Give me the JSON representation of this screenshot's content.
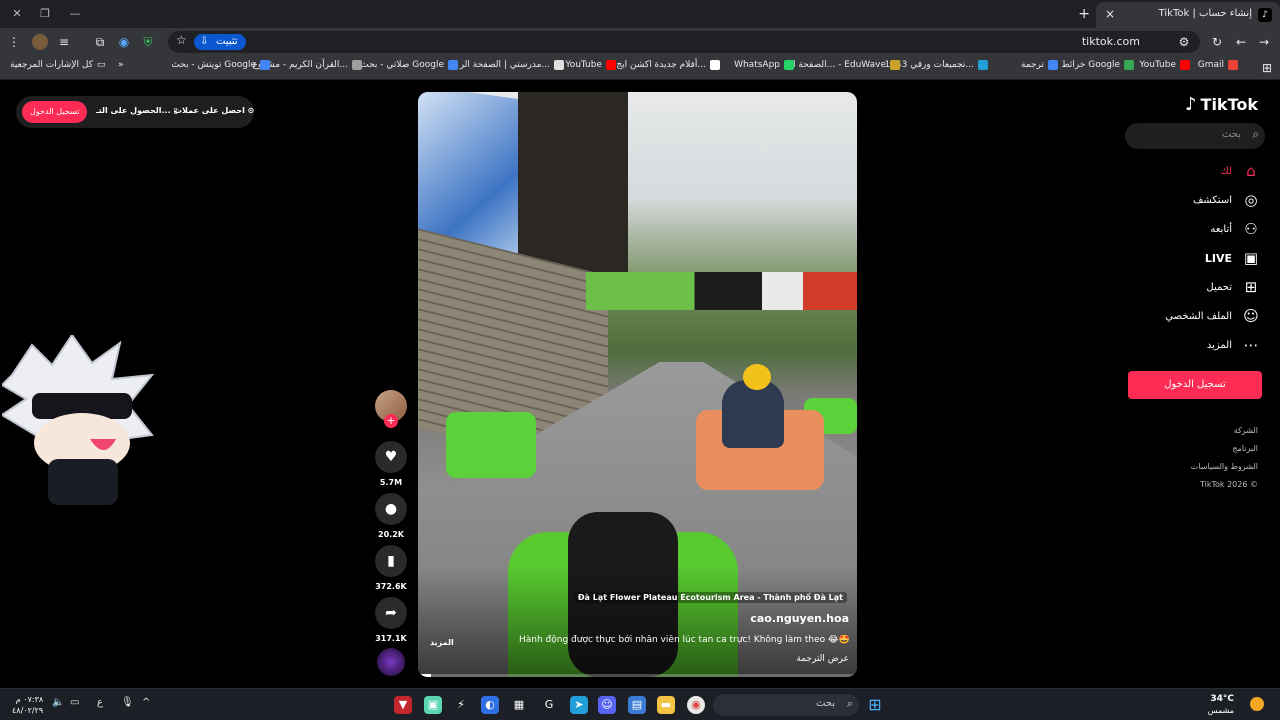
{
  "browser": {
    "tab_title": "إنشاء حساب | TikTok",
    "tab_close": "×",
    "new_tab": "+",
    "url": "tiktok.com",
    "install_label": "تثبيت",
    "minimize": "—",
    "restore": "❐",
    "close": "✕"
  },
  "bookmarks": {
    "all_bookmarks": "كل الإشارات المرجعية",
    "overflow": "»",
    "items": [
      {
        "label": "Gmail",
        "color": "#ea4335"
      },
      {
        "label": "YouTube",
        "color": "#ff0000"
      },
      {
        "label": "خرائط Google",
        "color": "#34a853"
      },
      {
        "label": "ترجمة",
        "color": "#4285f4"
      },
      {
        "label": "تجميعات ورقي 1443...",
        "color": "#229ed9"
      },
      {
        "label": "الصفحة ا... - EduWave",
        "color": "#c9a227"
      },
      {
        "label": "WhatsApp",
        "color": "#25d366"
      },
      {
        "label": "أفلام جديدة اكشن ايج...",
        "color": "#ffffff"
      },
      {
        "label": "YouTube",
        "color": "#ff0000"
      },
      {
        "label": "مدرستي | الصفحة الر...",
        "color": "#e0e0e0"
      },
      {
        "label": "صلاتي - بحث Google",
        "color": "#4285f4"
      },
      {
        "label": "القرآن الكريم - مشروع...",
        "color": "#9e9e9e"
      },
      {
        "label": "تويتش - بحث Google",
        "color": "#4285f4"
      }
    ]
  },
  "tiktok": {
    "logo": "TikTok",
    "search_placeholder": "بحث",
    "nav": [
      {
        "label": "لك",
        "icon": "home-icon",
        "glyph": "⌂"
      },
      {
        "label": "استكشف",
        "icon": "compass-icon",
        "glyph": "◎"
      },
      {
        "label": "أتابعه",
        "icon": "following-icon",
        "glyph": "⚇"
      },
      {
        "label": "LIVE",
        "icon": "live-icon",
        "glyph": "▣"
      },
      {
        "label": "تحميل",
        "icon": "upload-icon",
        "glyph": "⊞"
      },
      {
        "label": "الملف الشخصي",
        "icon": "profile-icon",
        "glyph": "☺"
      },
      {
        "label": "المزيد",
        "icon": "more-icon",
        "glyph": "⋯"
      }
    ],
    "login_label": "تسجيل الدخول",
    "footer": [
      "الشركة",
      "البرنامج",
      "الشروط والسياسات",
      "© TikTok 2026"
    ],
    "top_login": "تسجيل الدخول",
    "top_app": "الحصول على التـ...",
    "top_coins": "احصل على عملات"
  },
  "video": {
    "location": "Đà Lạt Flower Plateau Ecotourism Area - Thành phố Đà Lạt",
    "username": "cao.nguyen.hoa",
    "caption": "Hành động được thực bởi nhân viên lúc tan ca trực! Không làm theo 😂🤩 ...",
    "more": "المزيد",
    "translate": "عرض الترجمة",
    "progress": 0.03,
    "likes": "5.7M",
    "comments": "20.2K",
    "saves": "372.6K",
    "shares": "317.1K"
  },
  "taskbar": {
    "search_placeholder": "بحث",
    "temperature": "34°C",
    "weather": "مشمس",
    "time": "٠٧:٣٨ م",
    "date": "٤٨/٠٢/٢٩",
    "lang": "ع"
  }
}
